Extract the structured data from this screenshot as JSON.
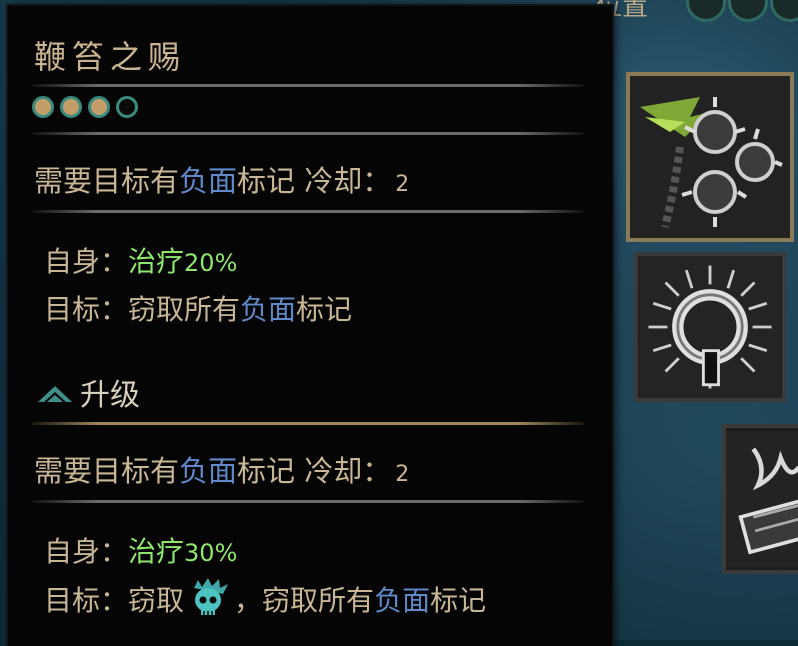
{
  "tooltip": {
    "title": "鞭笞之赐",
    "pips": [
      true,
      true,
      true,
      false
    ],
    "base": {
      "req_a": "需要目标有",
      "req_blue": "负面",
      "req_b": "标记",
      "cooldown_label": "冷却：",
      "cooldown_value": "2",
      "self_label": "自身：",
      "self_effect": "治疗",
      "self_value": "20%",
      "target_label": "目标：",
      "target_a": "窃取所有",
      "target_blue": "负面",
      "target_b": "标记"
    },
    "upgrade_label": "升级",
    "upgraded": {
      "req_a": "需要目标有",
      "req_blue": "负面",
      "req_b": "标记",
      "cooldown_label": "冷却：",
      "cooldown_value": "2",
      "self_label": "自身：",
      "self_effect": "治疗",
      "self_value": "30%",
      "target_label": "目标：",
      "target_a": "窃取",
      "target_sep": "，",
      "target_c": "窃取所有",
      "target_blue": "负面",
      "target_b": "标记"
    }
  },
  "top_fragment": "位置",
  "icons": [
    "upgrade-icon",
    "skull-icon",
    "flail-skill-icon",
    "thorn-ring-skill-icon",
    "chained-box-skill-icon"
  ],
  "colors": {
    "gold_text": "#c8b695",
    "heal_green": "#8ee66d",
    "negative_blue": "#5f89c9",
    "pip_gold": "#c49e68",
    "pip_ring": "#3b8a7e"
  }
}
